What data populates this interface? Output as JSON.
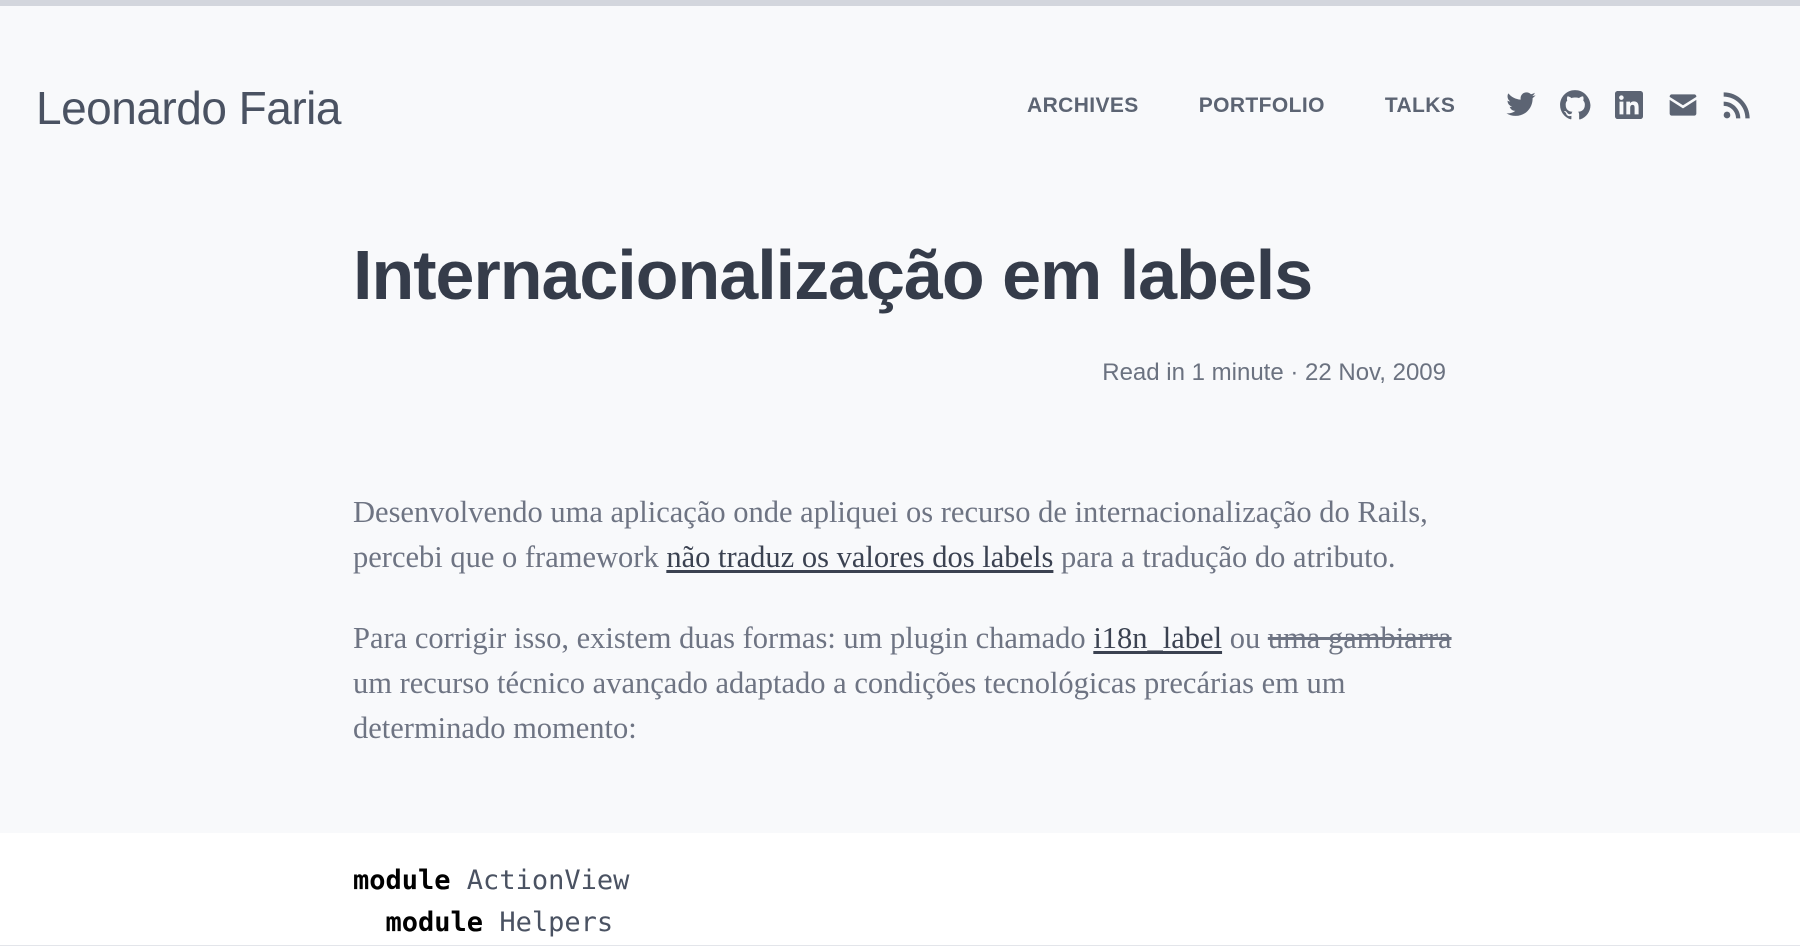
{
  "site": {
    "title": "Leonardo Faria"
  },
  "nav": {
    "items": [
      {
        "label": "ARCHIVES"
      },
      {
        "label": "PORTFOLIO"
      },
      {
        "label": "TALKS"
      }
    ]
  },
  "social": {
    "icons": [
      "twitter-icon",
      "github-icon",
      "linkedin-icon",
      "email-icon",
      "rss-icon"
    ]
  },
  "post": {
    "title": "Internacionalização em labels",
    "meta": "Read in 1 minute · 22 Nov, 2009",
    "p1": {
      "text_before": "Desenvolvendo uma aplicação onde apliquei os recurso de internacionalização do Rails, percebi que o framework ",
      "link": "não traduz os valores dos labels",
      "text_after": " para a tradução do atributo."
    },
    "p2": {
      "text_before": "Para corrigir isso, existem duas formas: um plugin chamado ",
      "link": "i18n_label",
      "text_mid": " ou ",
      "strike": "uma gambiarra",
      "text_after": " um recurso técnico avançado adaptado a condições tecnológicas precárias em um determinado momento:"
    }
  },
  "code": {
    "line1_kw": "module",
    "line1_name": " ActionView",
    "line2_indent": "  ",
    "line2_kw": "module",
    "line2_name": " Helpers"
  },
  "colors": {
    "background": "#f8f9fb",
    "title_text": "#353c4a",
    "nav_text": "#5c6473",
    "body_text": "#6e7483",
    "code_bg": "#ffffff"
  }
}
